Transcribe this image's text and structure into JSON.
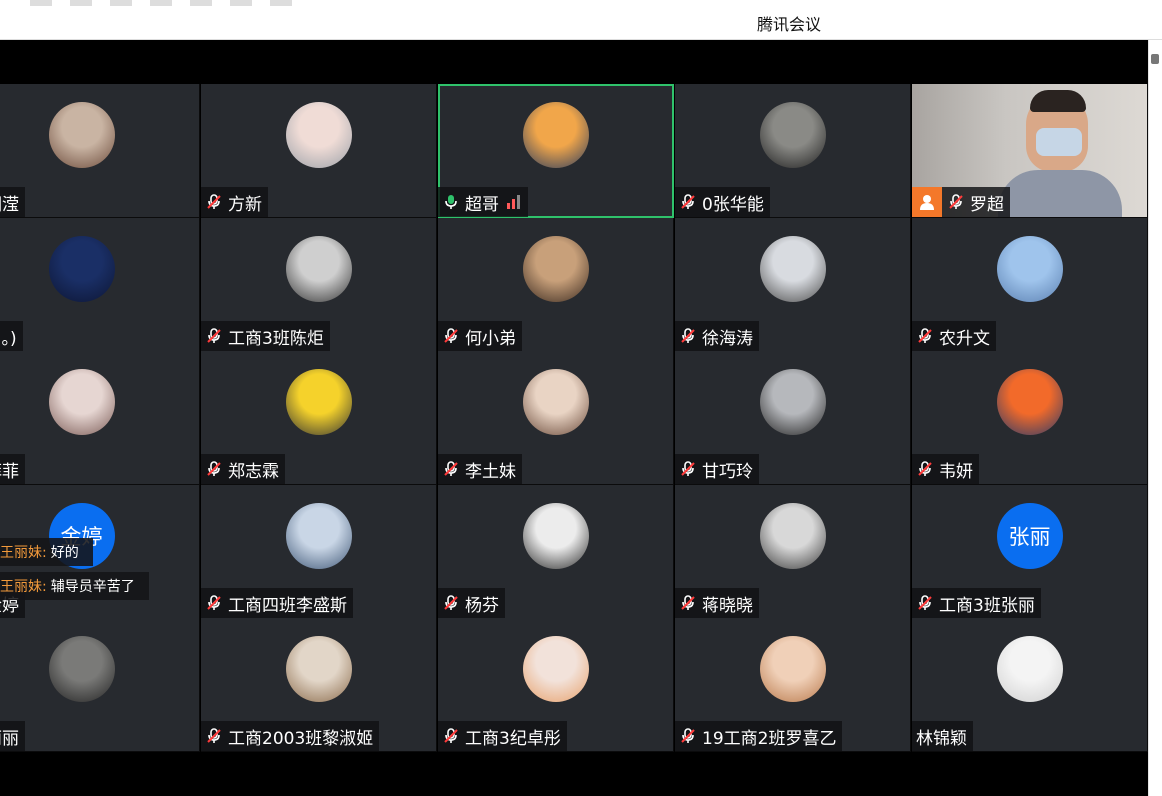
{
  "window": {
    "title": "腾讯会议"
  },
  "participants": [
    {
      "name": "范湘滢",
      "mic": "none",
      "avatar": "photo",
      "colors": [
        "#c9b4a3",
        "#6b4a3a"
      ]
    },
    {
      "name": "方新",
      "mic": "muted",
      "avatar": "photo",
      "colors": [
        "#f0dcd6",
        "#9aa0a8"
      ]
    },
    {
      "name": "超哥",
      "mic": "on",
      "avatar": "photo",
      "colors": [
        "#f1a64a",
        "#2b3c5e"
      ],
      "active": true
    },
    {
      "name": "0张华能",
      "mic": "muted",
      "avatar": "photo",
      "colors": [
        "#8a8a86",
        "#1f1f1f"
      ]
    },
    {
      "name": "罗超",
      "mic": "muted",
      "avatar": "video",
      "host": true
    },
    {
      "name": "。·ω·。)",
      "mic": "none",
      "avatar": "photo",
      "colors": [
        "#1a2f66",
        "#0d1533"
      ]
    },
    {
      "name": "工商3班陈炬",
      "mic": "muted",
      "avatar": "photo",
      "colors": [
        "#cfcfcf",
        "#333"
      ]
    },
    {
      "name": "何小弟",
      "mic": "muted",
      "avatar": "photo",
      "colors": [
        "#c8a07a",
        "#3a2a20"
      ]
    },
    {
      "name": "徐海涛",
      "mic": "muted",
      "avatar": "photo",
      "colors": [
        "#d8dbe0",
        "#4a4a4a"
      ]
    },
    {
      "name": "农升文",
      "mic": "muted",
      "avatar": "photo",
      "colors": [
        "#9fc4ec",
        "#5a7fb0"
      ]
    },
    {
      "name": "王菲菲",
      "mic": "none",
      "avatar": "photo",
      "colors": [
        "#e6d6d2",
        "#7a5a55"
      ]
    },
    {
      "name": "郑志霖",
      "mic": "muted",
      "avatar": "photo",
      "colors": [
        "#f5d22b",
        "#333"
      ]
    },
    {
      "name": "李土妹",
      "mic": "muted",
      "avatar": "photo",
      "colors": [
        "#e9d4c4",
        "#6a4a3a"
      ]
    },
    {
      "name": "甘巧玲",
      "mic": "muted",
      "avatar": "photo",
      "colors": [
        "#b6b8bc",
        "#222"
      ]
    },
    {
      "name": "韦妍",
      "mic": "muted",
      "avatar": "photo",
      "colors": [
        "#f26a2a",
        "#2a3a6a"
      ]
    },
    {
      "name": "伍金婷",
      "mic": "none",
      "avatar": "text",
      "text": "金婷"
    },
    {
      "name": "工商四班李盛斯",
      "mic": "muted",
      "avatar": "photo",
      "colors": [
        "#c9d6e6",
        "#3f5776"
      ]
    },
    {
      "name": "杨芬",
      "mic": "muted",
      "avatar": "photo",
      "colors": [
        "#ececec",
        "#2a2a2a"
      ]
    },
    {
      "name": "蒋晓晓",
      "mic": "muted",
      "avatar": "photo",
      "colors": [
        "#d8d8d8",
        "#3a3a3a"
      ]
    },
    {
      "name": "工商3班张丽",
      "mic": "muted",
      "avatar": "text",
      "text": "张丽"
    },
    {
      "name": "覃丽丽",
      "mic": "none",
      "avatar": "photo",
      "colors": [
        "#7a7a78",
        "#222"
      ]
    },
    {
      "name": "工商2003班黎淑姬",
      "mic": "muted",
      "avatar": "photo",
      "colors": [
        "#e2d6c8",
        "#8a6a4a"
      ]
    },
    {
      "name": "工商3纪卓彤",
      "mic": "muted",
      "avatar": "photo",
      "colors": [
        "#f2e2da",
        "#e7a06a"
      ]
    },
    {
      "name": "19工商2班罗喜乙",
      "mic": "muted",
      "avatar": "photo",
      "colors": [
        "#f0d0b8",
        "#b8784a"
      ]
    },
    {
      "name": "林锦颖",
      "mic": "none",
      "avatar": "photo",
      "colors": [
        "#f4f4f4",
        "#cfcfcf"
      ]
    }
  ],
  "chat": [
    {
      "sender": "王丽妹:",
      "message": "好的"
    },
    {
      "sender": "王丽妹:",
      "message": "辅导员辛苦了"
    }
  ]
}
